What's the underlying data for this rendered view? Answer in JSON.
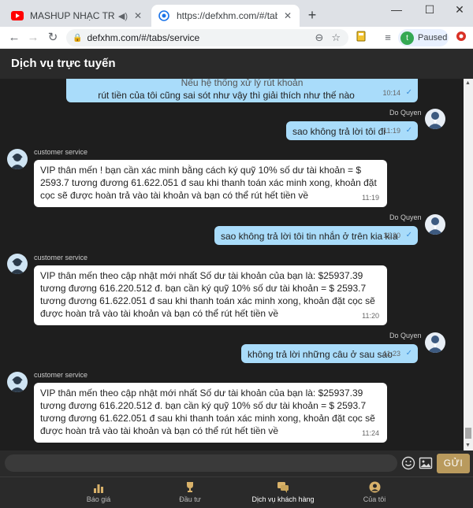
{
  "browser": {
    "tabs": [
      {
        "title": "MASHUP NHẠC TRẺ TIKTOK",
        "close": "✕"
      },
      {
        "title": "https://defxhm.com/#/tabs/servi",
        "close": "✕"
      }
    ],
    "new_tab": "+",
    "url": "defxhm.com/#/tabs/service",
    "profile_letter": "t",
    "profile_status": "Paused",
    "win_min": "—",
    "win_max": "☐",
    "win_close": "✕"
  },
  "app": {
    "title": "Dịch vụ trực tuyến",
    "messages": [
      {
        "from": "me",
        "text": "rút tiền của tôi cũng sai sót như vậy thì giải thích như thế nào",
        "time": "10:14",
        "partial_top": "Nếu hệ thống xử lý rút khoản"
      },
      {
        "from": "me",
        "sender": "Do Quyen",
        "text": "sao không trả lời tôi đi",
        "time": "11:19"
      },
      {
        "from": "agent",
        "sender": "customer service",
        "text": "VIP thân mến ! bạn cần xác minh bằng cách ký quỹ 10% số dư tài khoản = $ 2593.7 tương đương 61.622.051 đ sau khi thanh toán xác minh  xong, khoản đặt cọc sẽ được hoàn trả vào tài khoản và bạn có thể rút hết tiền về",
        "time": "11:19"
      },
      {
        "from": "me",
        "sender": "Do Quyen",
        "text": "sao không trả lời tôi tin nhắn ở trên kia kìa",
        "time": "11:20"
      },
      {
        "from": "agent",
        "sender": "customer service",
        "text": "VIP thân mến theo cập nhật mới nhất Số dư tài khoản của bạn là: $25937.39 tương đương 616.220.512 đ. bạn cần ký quỹ 10% số dư tài khoản = $ 2593.7 tương đương 61.622.051 đ sau khi thanh toán xác minh  xong, khoản đặt cọc sẽ được hoàn trả vào tài khoản và bạn có thể rút hết tiền về",
        "time": "11:20"
      },
      {
        "from": "me",
        "sender": "Do Quyen",
        "text": "không trả lời những câu ở sau sao",
        "time": "11:23"
      },
      {
        "from": "agent",
        "sender": "customer service",
        "text": "VIP thân mến theo cập nhật mới nhất Số dư tài khoản của bạn là: $25937.39 tương đương 616.220.512 đ. bạn cần ký quỹ 10% số dư tài khoản = $ 2593.7 tương đương 61.622.051 đ sau khi thanh toán xác minh  xong, khoản đặt cọc sẽ được hoàn trả vào tài khoản và bạn có thể rút hết tiền về",
        "time": "11:24"
      }
    ],
    "input_placeholder": "",
    "send_label": "GỬI",
    "nav": [
      {
        "label": "Báo giá",
        "icon": "chart-icon"
      },
      {
        "label": "Đầu tư",
        "icon": "trophy-icon"
      },
      {
        "label": "Dịch vụ khách hàng",
        "icon": "chat-icon",
        "active": true
      },
      {
        "label": "Của tôi",
        "icon": "user-icon"
      }
    ],
    "colors": {
      "out_bubble": "#a9dcfa",
      "send_button": "#b99a5d",
      "background": "#1e1e1e"
    }
  }
}
